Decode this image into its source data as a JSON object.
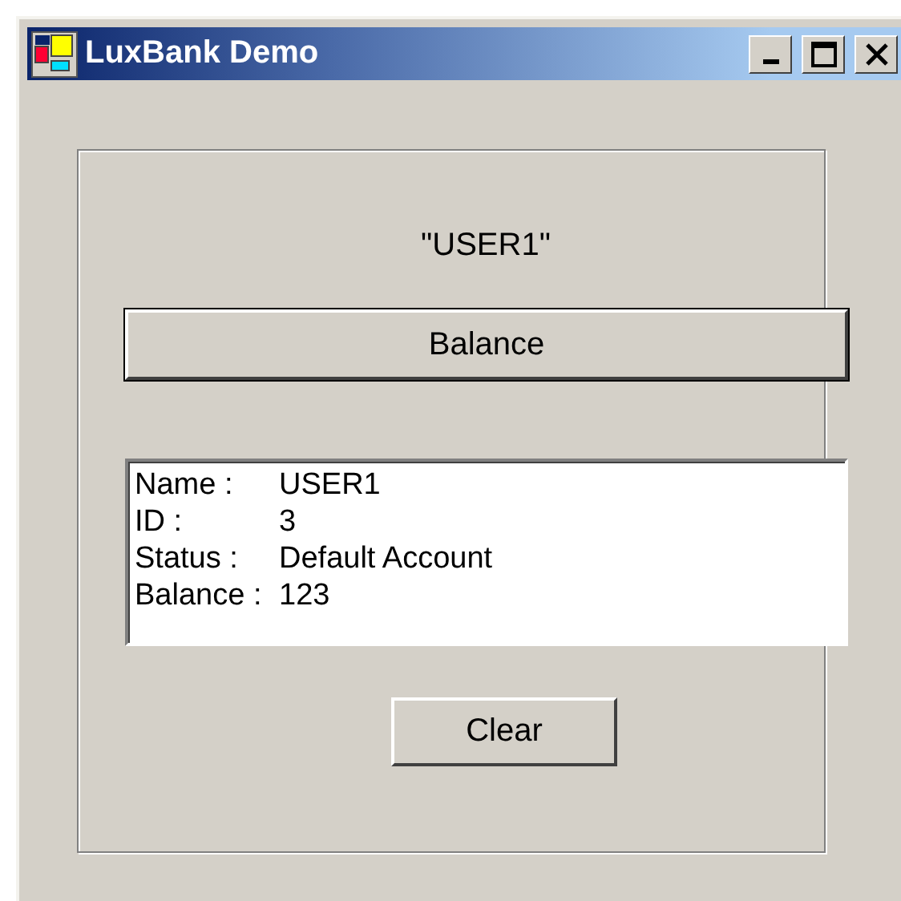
{
  "window": {
    "title": "LuxBank Demo"
  },
  "user_label": "\"USER1\"",
  "balance_button": "Balance",
  "details": [
    {
      "label": "Name :",
      "value": "USER1"
    },
    {
      "label": "ID :",
      "value": "3"
    },
    {
      "label": "Status :",
      "value": "Default Account"
    },
    {
      "label": "Balance :",
      "value": "123"
    }
  ],
  "clear_button": "Clear"
}
